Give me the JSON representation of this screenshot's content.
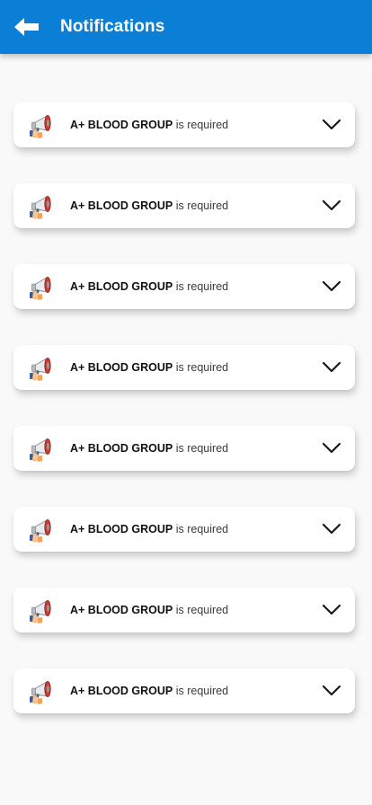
{
  "header": {
    "back_icon": "arrow-left-icon",
    "title": "Notifications",
    "background_color": "#0b7fd6"
  },
  "notifications": [
    {
      "blood_group": "A+ BLOOD GROUP",
      "suffix": "is required",
      "icon": "megaphone-icon",
      "expand_icon": "chevron-down-icon"
    },
    {
      "blood_group": "A+ BLOOD GROUP",
      "suffix": "is required",
      "icon": "megaphone-icon",
      "expand_icon": "chevron-down-icon"
    },
    {
      "blood_group": "A+ BLOOD GROUP",
      "suffix": "is required",
      "icon": "megaphone-icon",
      "expand_icon": "chevron-down-icon"
    },
    {
      "blood_group": "A+ BLOOD GROUP",
      "suffix": "is required",
      "icon": "megaphone-icon",
      "expand_icon": "chevron-down-icon"
    },
    {
      "blood_group": "A+ BLOOD GROUP",
      "suffix": "is required",
      "icon": "megaphone-icon",
      "expand_icon": "chevron-down-icon"
    },
    {
      "blood_group": "A+ BLOOD GROUP",
      "suffix": "is required",
      "icon": "megaphone-icon",
      "expand_icon": "chevron-down-icon"
    },
    {
      "blood_group": "A+ BLOOD GROUP",
      "suffix": "is required",
      "icon": "megaphone-icon",
      "expand_icon": "chevron-down-icon"
    },
    {
      "blood_group": "A+ BLOOD GROUP",
      "suffix": "is required",
      "icon": "megaphone-icon",
      "expand_icon": "chevron-down-icon"
    }
  ]
}
